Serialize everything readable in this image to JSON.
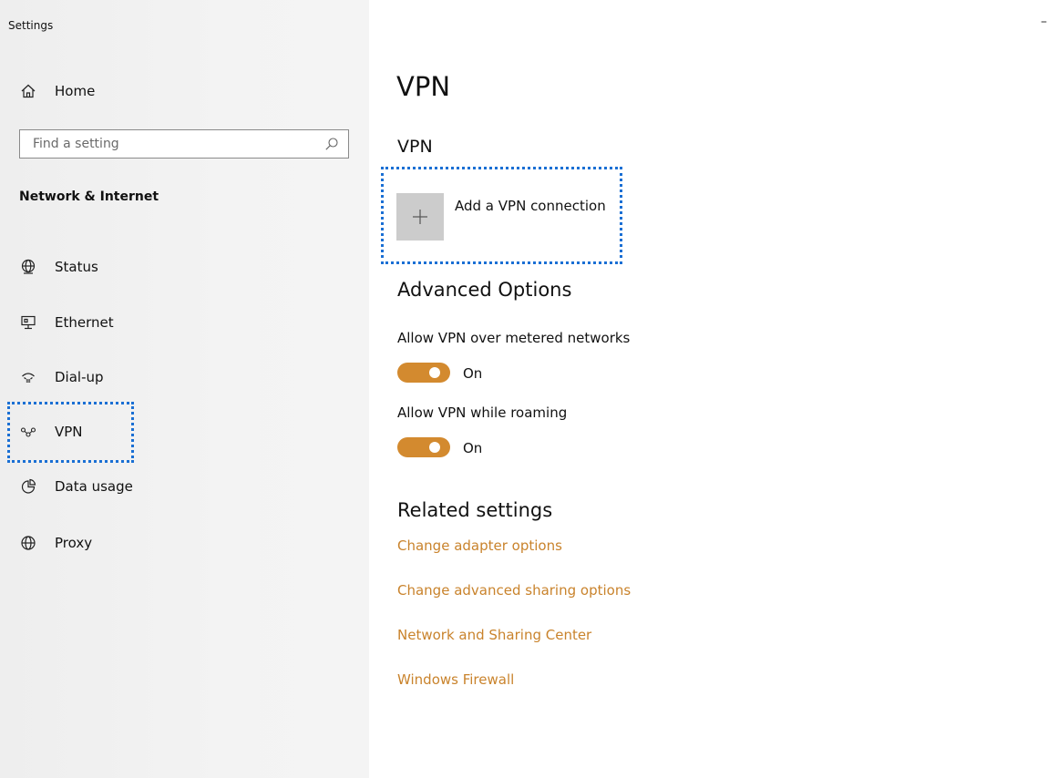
{
  "window": {
    "title": "Settings",
    "minimize_glyph": "–"
  },
  "sidebar": {
    "home_label": "Home",
    "search_placeholder": "Find a setting",
    "section_title": "Network & Internet",
    "items": [
      {
        "label": "Status",
        "icon": "globe-status-icon"
      },
      {
        "label": "Ethernet",
        "icon": "ethernet-icon"
      },
      {
        "label": "Dial-up",
        "icon": "dialup-icon"
      },
      {
        "label": "VPN",
        "icon": "vpn-icon"
      },
      {
        "label": "Data usage",
        "icon": "data-usage-icon"
      },
      {
        "label": "Proxy",
        "icon": "globe-proxy-icon"
      }
    ]
  },
  "main": {
    "page_title": "VPN",
    "vpn_section": {
      "title": "VPN",
      "add_label": "Add a VPN connection"
    },
    "advanced": {
      "title": "Advanced Options",
      "options": [
        {
          "label": "Allow VPN over metered networks",
          "state": "On"
        },
        {
          "label": "Allow VPN while roaming",
          "state": "On"
        }
      ]
    },
    "related": {
      "title": "Related settings",
      "links": [
        "Change adapter options",
        "Change advanced sharing options",
        "Network and Sharing Center",
        "Windows Firewall"
      ]
    }
  },
  "colors": {
    "accent": "#d38a2f",
    "link": "#c9832c",
    "focus_outline": "#1a6fd4",
    "sidebar_bg": "#f2f2f2"
  }
}
